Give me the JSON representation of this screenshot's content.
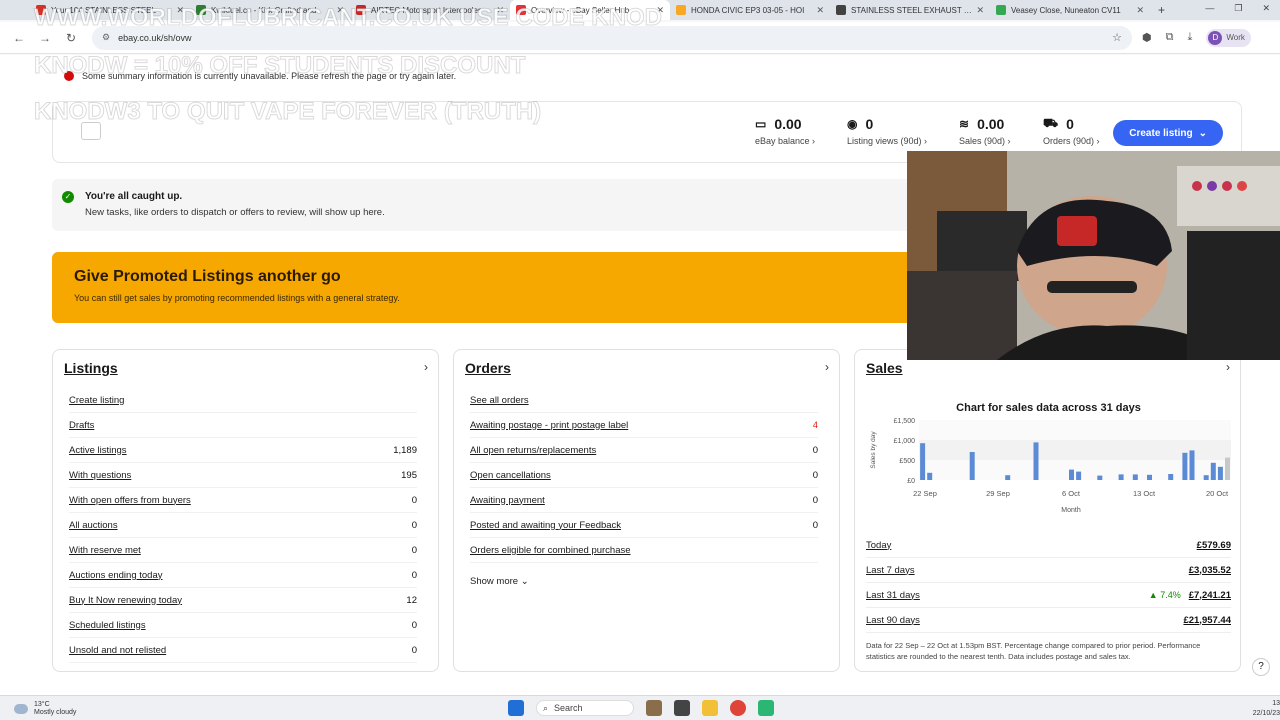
{
  "browser": {
    "tabs": [
      {
        "label": "Your 104 STAINLESS STEEL",
        "color": "#d93025",
        "active": false
      },
      {
        "label": "Kwikfuel.co - Kirk Crafted and",
        "color": "#2e7d32",
        "active": false
      },
      {
        "label": "AIRTEC Motorsport Intercooler",
        "color": "#c62828",
        "active": false
      },
      {
        "label": "Overview - eBay Seller Hub",
        "color": "#e53238",
        "active": true
      },
      {
        "label": "HONDA CIVIC EP3 03-05 - HOI",
        "color": "#f9a825",
        "active": false
      },
      {
        "label": "STAINLESS STEEL EXHAUST SILI",
        "color": "#424242",
        "active": false
      },
      {
        "label": "Veasey Close, Nuneaton CV11",
        "color": "#34a853",
        "active": false
      }
    ],
    "url": "ebay.co.uk/sh/ovw",
    "profile_label": "Work",
    "profile_initial": "D"
  },
  "overlay": {
    "line1": "WWW.WORLDOFLUBRICANT.CO.UK USE CODE KNOD",
    "line2": "KNODW = 10% OFF STUDENTS DISCOUNT",
    "line3": "KNODW3 TO QUIT VAPE FOREVER (TRUTH)"
  },
  "notice": "Some summary information is currently unavailable. Please refresh the page or try again later.",
  "summary": {
    "metrics": [
      {
        "value": "0.00",
        "label": "eBay balance",
        "icon": "wallet-icon"
      },
      {
        "value": "0",
        "label": "Listing views (90d)",
        "icon": "eye-icon"
      },
      {
        "value": "0.00",
        "label": "Sales (90d)",
        "icon": "money-icon"
      },
      {
        "value": "0",
        "label": "Orders (90d)",
        "icon": "truck-icon"
      }
    ],
    "create_listing": "Create listing"
  },
  "caught_up": {
    "title": "You're all caught up.",
    "subtitle": "New tasks, like orders to dispatch or offers to review, will show up here."
  },
  "promo": {
    "title": "Give Promoted Listings another go",
    "subtitle": "You can still get sales by promoting recommended listings with a general strategy."
  },
  "listings": {
    "title": "Listings",
    "rows": [
      {
        "label": "Create listing",
        "value": ""
      },
      {
        "label": "Drafts",
        "value": ""
      },
      {
        "label": "Active listings",
        "value": "1,189"
      },
      {
        "label": "With questions",
        "value": "195"
      },
      {
        "label": "With open offers from buyers",
        "value": "0"
      },
      {
        "label": "All auctions",
        "value": "0"
      },
      {
        "label": "With reserve met",
        "value": "0"
      },
      {
        "label": "Auctions ending today",
        "value": "0"
      },
      {
        "label": "Buy It Now renewing today",
        "value": "12"
      },
      {
        "label": "Scheduled listings",
        "value": "0"
      },
      {
        "label": "Unsold and not relisted",
        "value": "0"
      }
    ]
  },
  "orders": {
    "title": "Orders",
    "rows": [
      {
        "label": "See all orders",
        "value": ""
      },
      {
        "label": "Awaiting postage - print postage label",
        "value": "4"
      },
      {
        "label": "All open returns/replacements",
        "value": "0"
      },
      {
        "label": "Open cancellations",
        "value": "0"
      },
      {
        "label": "Awaiting payment",
        "value": "0"
      },
      {
        "label": "Posted and awaiting your Feedback",
        "value": "0"
      },
      {
        "label": "Orders eligible for combined purchase",
        "value": ""
      }
    ],
    "show_more": "Show more"
  },
  "sales": {
    "title": "Sales",
    "chart_title": "Chart for sales data across 31 days",
    "rows": [
      {
        "label": "Today",
        "value": "£579.69",
        "change": ""
      },
      {
        "label": "Last 7 days",
        "value": "£3,035.52",
        "change": ""
      },
      {
        "label": "Last 31 days",
        "value": "£7,241.21",
        "change": "7.4%"
      },
      {
        "label": "Last 90 days",
        "value": "£21,957.44",
        "change": ""
      }
    ],
    "note": "Data for 22 Sep – 22 Oct at 1.53pm BST. Percentage change compared to prior period. Performance statistics are rounded to the nearest tenth. Data includes postage and sales tax."
  },
  "chart_data": {
    "type": "bar",
    "title": "Chart for sales data across 31 days",
    "xlabel": "Month",
    "ylabel": "Sales by day",
    "ylim": [
      0,
      1500
    ],
    "yticks": [
      "£0",
      "£500",
      "£1,000",
      "£1,500"
    ],
    "xticks": [
      "22 Sep",
      "29 Sep",
      "6 Oct",
      "13 Oct",
      "20 Oct"
    ],
    "values": [
      920,
      180,
      0,
      0,
      0,
      0,
      0,
      700,
      0,
      0,
      0,
      0,
      120,
      0,
      0,
      0,
      940,
      0,
      0,
      0,
      0,
      260,
      210,
      0,
      0,
      110,
      0,
      0,
      140,
      0,
      140,
      0,
      130,
      0,
      0,
      150,
      0,
      680,
      740,
      0,
      120,
      430,
      330,
      560
    ],
    "colors": {
      "bar": "#5b8bd4",
      "last": "#c8c8c8"
    },
    "grid": true
  },
  "taskbar": {
    "weather_temp": "13°C",
    "weather_desc": "Mostly cloudy",
    "search": "Search",
    "time": "13",
    "date": "22/10/23"
  }
}
